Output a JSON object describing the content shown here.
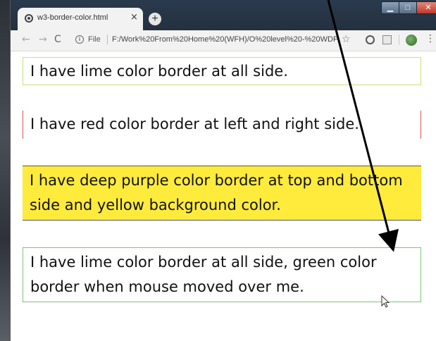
{
  "browser": {
    "tab_title": "w3-border-color.html",
    "tab_close": "×",
    "new_tab": "+",
    "window_buttons": {
      "minimize": "▁",
      "maximize": "□",
      "close": "✕"
    }
  },
  "toolbar": {
    "back": "←",
    "forward": "→",
    "reload": "C",
    "info": "i",
    "file_label": "File",
    "url": "F:/Work%20From%20Home%20(WFH)/O%20level%20-%20WDP/html%2...",
    "star": "☆",
    "menu": "⋮"
  },
  "content": {
    "boxes": [
      {
        "text": "I have lime color border at all side."
      },
      {
        "text": "I have red color border at left and right side."
      },
      {
        "text": "I have deep purple color border at top and bottom side and yellow background color."
      },
      {
        "text": "I have lime color border at all side, green color border when mouse moved over me."
      }
    ]
  },
  "colors": {
    "lime_border": "#c6e07a",
    "red_border": "#d9534f",
    "purple_border": "#555555",
    "yellow_bg": "#ffeb3b",
    "green_border": "#7cc576"
  }
}
